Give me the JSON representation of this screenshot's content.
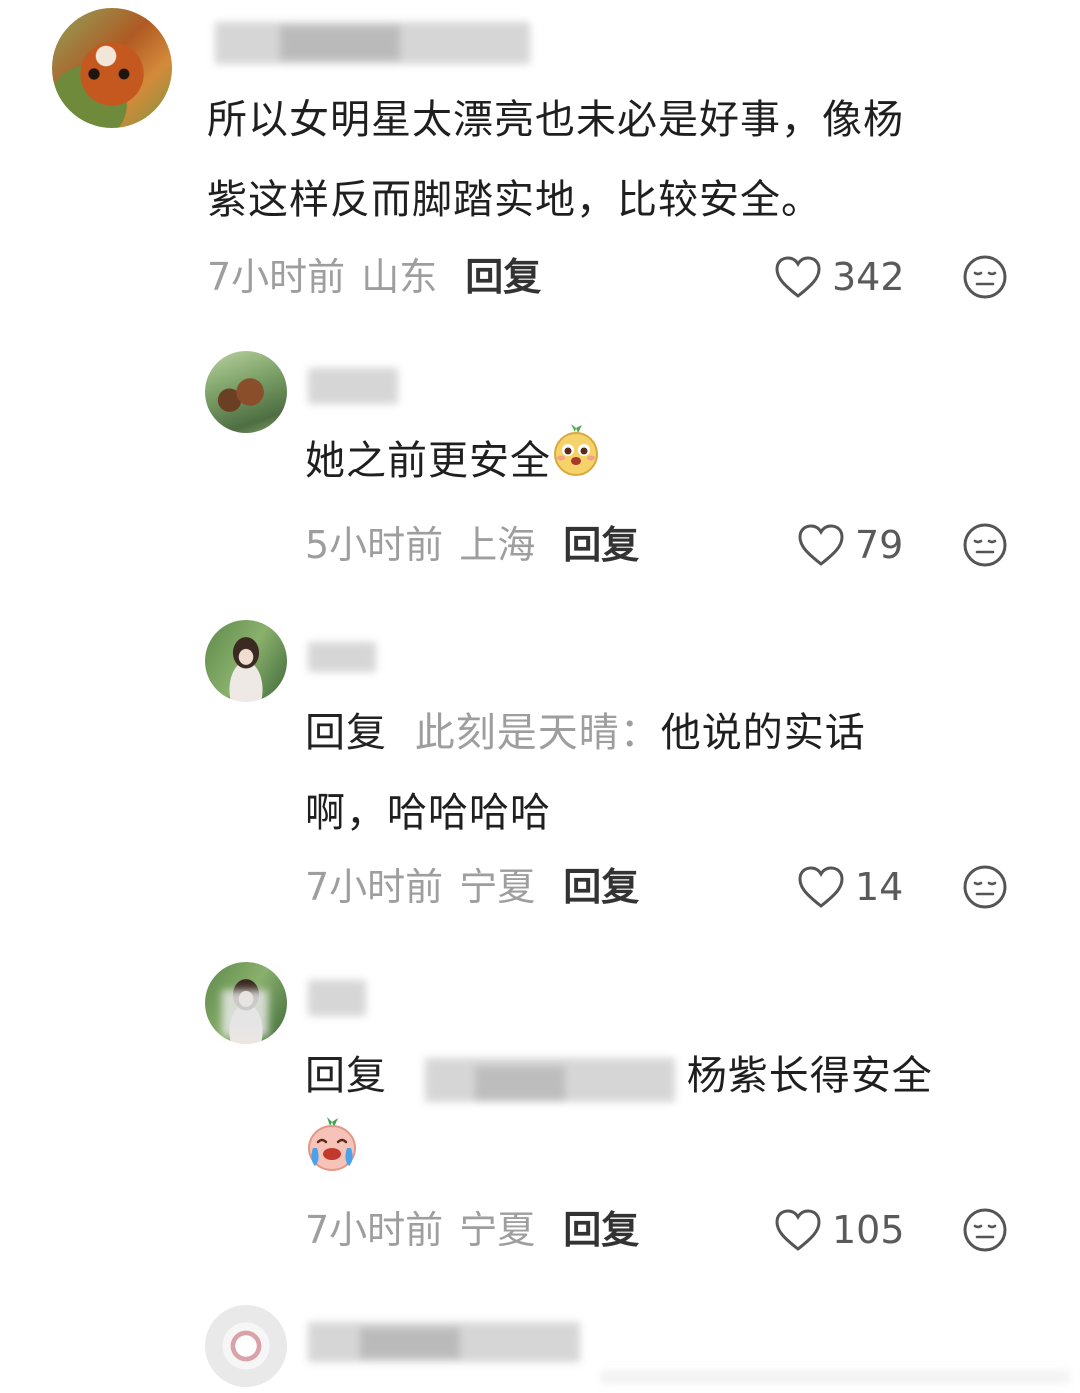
{
  "comments": [
    {
      "text": "所以女明星太漂亮也未必是好事，像杨紫这样反而脚踏实地，比较安全。",
      "line1": "所以女明星太漂亮也未必是好事，像杨",
      "line2": "紫这样反而脚踏实地，比较安全。",
      "time": "7小时前",
      "location": "山东",
      "reply_label": "回复",
      "likes": "342"
    },
    {
      "text": "她之前更安全",
      "time": "5小时前",
      "location": "上海",
      "reply_label": "回复",
      "likes": "79"
    },
    {
      "prefix": "回复",
      "target": "此刻是天晴：",
      "line1_tail": "他说的实话",
      "line2": "啊，哈哈哈哈",
      "time": "7小时前",
      "location": "宁夏",
      "reply_label": "回复",
      "likes": "14"
    },
    {
      "prefix": "回复",
      "line1_tail": "杨紫长得安全",
      "time": "7小时前",
      "location": "宁夏",
      "reply_label": "回复",
      "likes": "105"
    }
  ],
  "icons": {
    "like": "heart-outline-icon",
    "dislike": "neutral-face-icon",
    "emoji1": "mango-cartoon-emoji",
    "emoji2": "crying-peach-emoji"
  },
  "colors": {
    "meta_gray": "#9e9e9e",
    "text": "#1f1f1f"
  }
}
